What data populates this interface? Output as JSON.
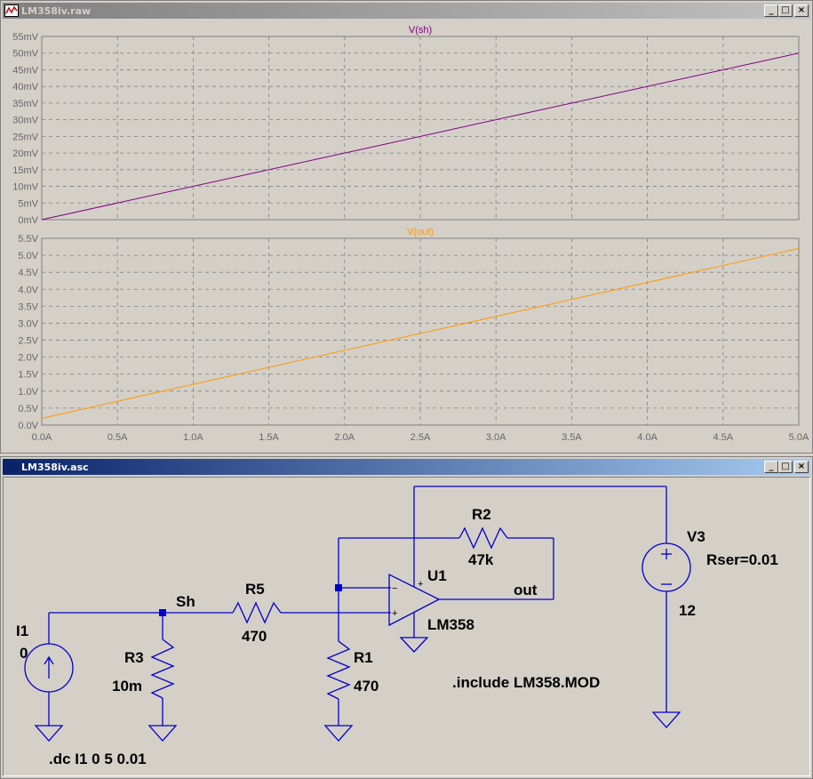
{
  "waveform_window": {
    "title": "LM358iv.raw",
    "controls": {
      "minimize": "_",
      "maximize": "□",
      "close": "×"
    },
    "background_color": "#d4d0c8"
  },
  "schematic_window": {
    "title": "LM358iv.asc",
    "controls": {
      "minimize": "_",
      "maximize": "□",
      "close": "×"
    },
    "wire_color": "#0000cc",
    "background_color": "#d4d0c8"
  },
  "chart_data": [
    {
      "type": "line",
      "title": "V(sh)",
      "series": [
        {
          "name": "V(sh)",
          "color": "#800080",
          "x": [
            0,
            5
          ],
          "y": [
            0,
            50
          ]
        }
      ],
      "xlim": [
        0,
        5
      ],
      "ylim": [
        0,
        55
      ],
      "yticks": [
        "0mV",
        "5mV",
        "10mV",
        "15mV",
        "20mV",
        "25mV",
        "30mV",
        "35mV",
        "40mV",
        "45mV",
        "50mV",
        "55mV"
      ],
      "grid": true
    },
    {
      "type": "line",
      "title": "V(out)",
      "series": [
        {
          "name": "V(out)",
          "color": "#ff9900",
          "x": [
            0,
            5
          ],
          "y": [
            0.2,
            5.2
          ]
        }
      ],
      "xlim": [
        0,
        5
      ],
      "ylim": [
        0,
        5.5
      ],
      "yticks": [
        "0.0V",
        "0.5V",
        "1.0V",
        "1.5V",
        "2.0V",
        "2.5V",
        "3.0V",
        "3.5V",
        "4.0V",
        "4.5V",
        "5.0V",
        "5.5V"
      ],
      "xticks": [
        "0.0A",
        "0.5A",
        "1.0A",
        "1.5A",
        "2.0A",
        "2.5A",
        "3.0A",
        "3.5A",
        "4.0A",
        "4.5A",
        "5.0A"
      ],
      "grid": true
    }
  ],
  "schematic": {
    "components": {
      "I1": {
        "name": "I1",
        "value": "0"
      },
      "R3": {
        "name": "R3",
        "value": "10m"
      },
      "R5": {
        "name": "R5",
        "value": "470"
      },
      "R1": {
        "name": "R1",
        "value": "470"
      },
      "R2": {
        "name": "R2",
        "value": "47k"
      },
      "U1": {
        "name": "U1",
        "value": "LM358",
        "plus": "+",
        "minus": "−"
      },
      "V3": {
        "name": "V3",
        "value": "12",
        "param": "Rser=0.01"
      }
    },
    "net_labels": {
      "sh": "Sh",
      "out": "out"
    },
    "directives": {
      "include": ".include LM358.MOD",
      "analysis": ".dc I1 0 5 0.01"
    }
  }
}
